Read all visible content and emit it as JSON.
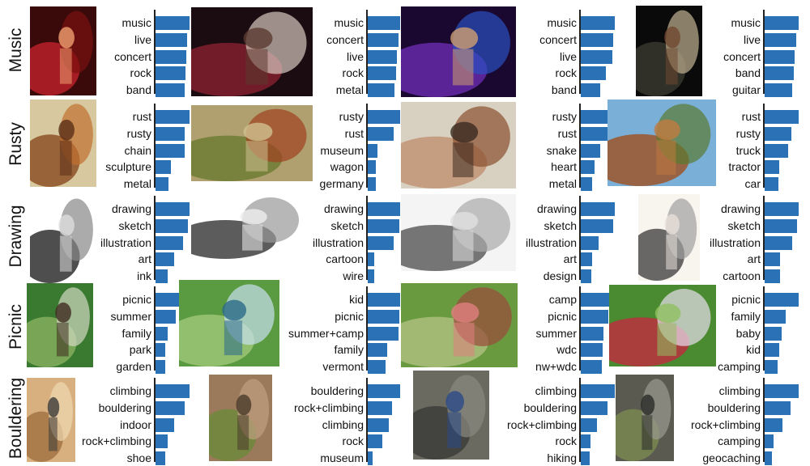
{
  "colors": {
    "bar": "#2a72b5",
    "axis": "#222222",
    "text": "#111111"
  },
  "rows": [
    {
      "label": "Music",
      "panels": [
        {
          "image": "concert-guitarist-red-light",
          "tags": [
            "music",
            "live",
            "concert",
            "rock",
            "band"
          ],
          "scores": [
            1.0,
            0.93,
            0.91,
            0.87,
            0.85
          ]
        },
        {
          "image": "concert-singer-on-stage",
          "tags": [
            "music",
            "concert",
            "live",
            "rock",
            "metal"
          ],
          "scores": [
            1.0,
            0.95,
            0.9,
            0.87,
            0.82
          ]
        },
        {
          "image": "concert-mandolin-purple-light",
          "tags": [
            "music",
            "concert",
            "live",
            "rock",
            "band"
          ],
          "scores": [
            1.0,
            0.96,
            0.92,
            0.74,
            0.58
          ]
        },
        {
          "image": "guitarist-singing-dark",
          "tags": [
            "music",
            "live",
            "concert",
            "band",
            "guitar"
          ],
          "scores": [
            1.0,
            0.93,
            0.88,
            0.85,
            0.8
          ]
        }
      ]
    },
    {
      "label": "Rusty",
      "panels": [
        {
          "image": "rusty-chain",
          "tags": [
            "rust",
            "rusty",
            "chain",
            "sculpture",
            "metal"
          ],
          "scores": [
            1.0,
            0.85,
            0.85,
            0.46,
            0.37
          ]
        },
        {
          "image": "rusty-plow-in-grass",
          "tags": [
            "rusty",
            "rust",
            "museum",
            "wagon",
            "germany"
          ],
          "scores": [
            1.0,
            0.8,
            0.3,
            0.26,
            0.24
          ]
        },
        {
          "image": "rusty-pipe-closeup",
          "tags": [
            "rusty",
            "rust",
            "snake",
            "heart",
            "metal"
          ],
          "scores": [
            1.0,
            0.97,
            0.56,
            0.41,
            0.33
          ]
        },
        {
          "image": "rusty-old-truck",
          "tags": [
            "rust",
            "rusty",
            "truck",
            "tractor",
            "car"
          ],
          "scores": [
            1.0,
            0.78,
            0.69,
            0.44,
            0.4
          ]
        }
      ]
    },
    {
      "label": "Drawing",
      "panels": [
        {
          "image": "caricature-woman-sketch",
          "tags": [
            "drawing",
            "sketch",
            "illustration",
            "art",
            "ink"
          ],
          "scores": [
            1.0,
            0.96,
            0.82,
            0.55,
            0.35
          ]
        },
        {
          "image": "gas-mask-sketch",
          "tags": [
            "drawing",
            "sketch",
            "illustration",
            "cartoon",
            "wire"
          ],
          "scores": [
            1.0,
            0.98,
            0.8,
            0.2,
            0.2
          ]
        },
        {
          "image": "two-faces-pencil-sketch",
          "tags": [
            "drawing",
            "sketch",
            "illustration",
            "art",
            "design"
          ],
          "scores": [
            1.0,
            0.96,
            0.53,
            0.33,
            0.3
          ]
        },
        {
          "image": "woman-cartoon-speech-bubble",
          "tags": [
            "drawing",
            "sketch",
            "illustration",
            "art",
            "cartoon"
          ],
          "scores": [
            1.0,
            0.95,
            0.81,
            0.46,
            0.45
          ]
        }
      ]
    },
    {
      "label": "Picnic",
      "panels": [
        {
          "image": "group-picnic-in-park",
          "tags": [
            "picnic",
            "summer",
            "family",
            "park",
            "garden"
          ],
          "scores": [
            1.0,
            0.6,
            0.35,
            0.29,
            0.28
          ]
        },
        {
          "image": "woman-in-grass-field",
          "tags": [
            "kid",
            "picnic",
            "summer+camp",
            "family",
            "vermont"
          ],
          "scores": [
            1.0,
            0.98,
            0.96,
            0.6,
            0.56
          ]
        },
        {
          "image": "woman-pink-hair-picnic",
          "tags": [
            "camp",
            "picnic",
            "summer",
            "wdc",
            "nw+wdc"
          ],
          "scores": [
            1.0,
            0.8,
            0.66,
            0.65,
            0.62
          ]
        },
        {
          "image": "mother-child-picnic-blanket",
          "tags": [
            "picnic",
            "family",
            "baby",
            "kid",
            "camping"
          ],
          "scores": [
            1.0,
            0.62,
            0.5,
            0.44,
            0.37
          ]
        }
      ]
    },
    {
      "label": "Bouldering",
      "panels": [
        {
          "image": "indoor-climbing-wall",
          "tags": [
            "climbing",
            "bouldering",
            "indoor",
            "rock+climbing",
            "shoe"
          ],
          "scores": [
            1.0,
            0.85,
            0.55,
            0.35,
            0.28
          ]
        },
        {
          "image": "outdoor-rock-boulder",
          "tags": [
            "bouldering",
            "rock+climbing",
            "climbing",
            "rock",
            "museum"
          ],
          "scores": [
            1.0,
            0.76,
            0.66,
            0.45,
            0.15
          ]
        },
        {
          "image": "climber-on-boulder",
          "tags": [
            "climbing",
            "bouldering",
            "rock+climbing",
            "rock",
            "hiking"
          ],
          "scores": [
            1.0,
            0.78,
            0.47,
            0.28,
            0.27
          ]
        },
        {
          "image": "climber-rock-face",
          "tags": [
            "climbing",
            "bouldering",
            "rock+climbing",
            "camping",
            "geocaching"
          ],
          "scores": [
            1.0,
            0.76,
            0.52,
            0.26,
            0.22
          ]
        }
      ]
    }
  ]
}
